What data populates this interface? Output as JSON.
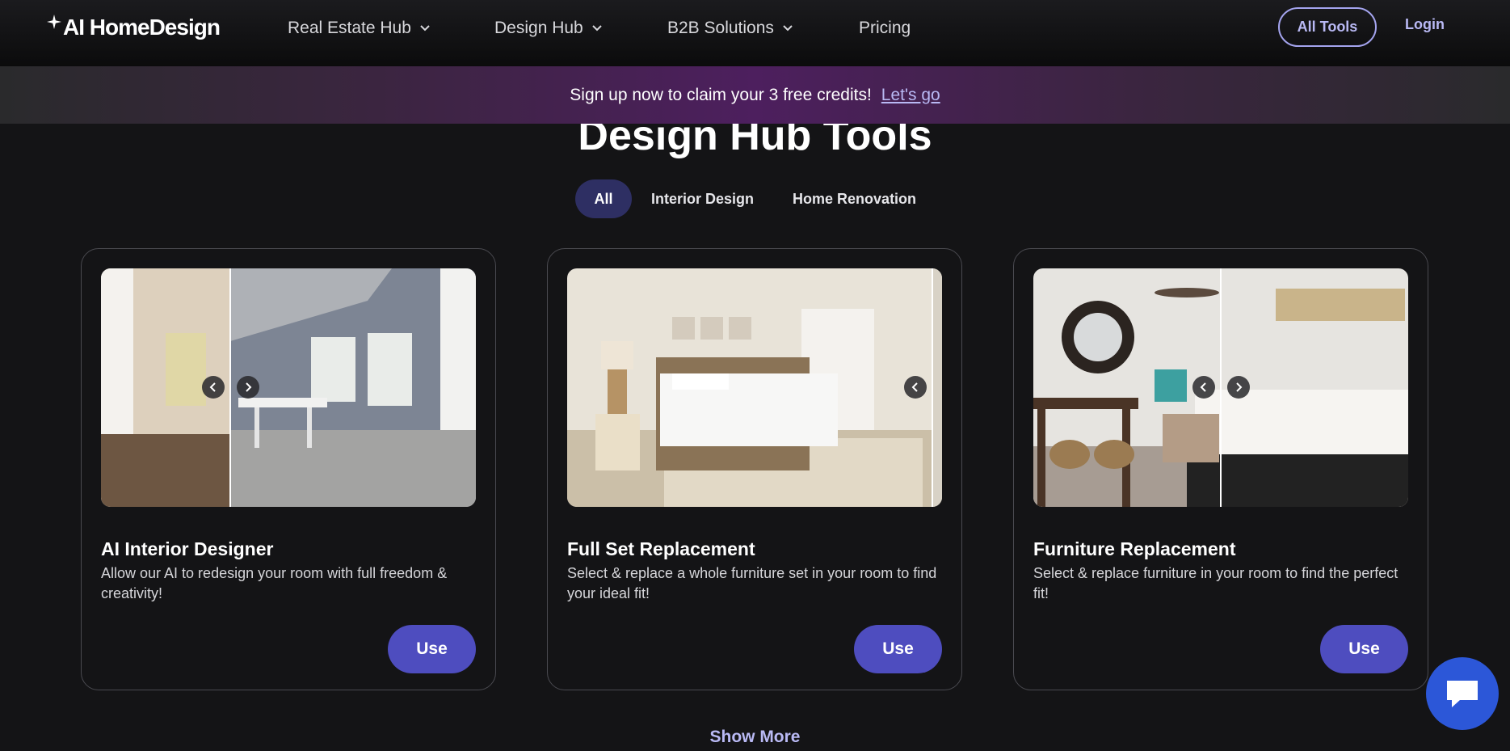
{
  "header": {
    "logo": "AI HomeDesign",
    "nav": [
      {
        "label": "Real Estate Hub"
      },
      {
        "label": "Design Hub"
      },
      {
        "label": "B2B Solutions"
      },
      {
        "label": "Pricing"
      }
    ],
    "all_tools": "All Tools",
    "login": "Login"
  },
  "banner": {
    "text": "Sign up now to claim your 3 free credits!",
    "link": "Let's go"
  },
  "page": {
    "title": "Design Hub Tools",
    "tabs": [
      "All",
      "Interior Design",
      "Home Renovation"
    ],
    "active_tab": "All",
    "show_more": "Show More"
  },
  "cards": [
    {
      "title": "AI Interior Designer",
      "description": "Allow our AI to redesign your room with full freedom & creativity!",
      "button": "Use",
      "image": "dining room before/after comparison"
    },
    {
      "title": "Full Set Replacement",
      "description": "Select & replace a whole furniture set in your room to find your ideal fit!",
      "button": "Use",
      "image": "bedroom furniture set comparison"
    },
    {
      "title": "Furniture Replacement",
      "description": "Select & replace furniture in your room to find the perfect fit!",
      "button": "Use",
      "image": "bedroom furniture comparison"
    }
  ],
  "colors": {
    "background": "#141416",
    "accent": "#4e4dbf",
    "link": "#b9b9f4",
    "chat": "#2c57d8"
  },
  "icons": [
    "sparkle-icon",
    "chevron-down-icon",
    "chevron-left-icon",
    "chevron-right-icon",
    "chat-icon"
  ]
}
